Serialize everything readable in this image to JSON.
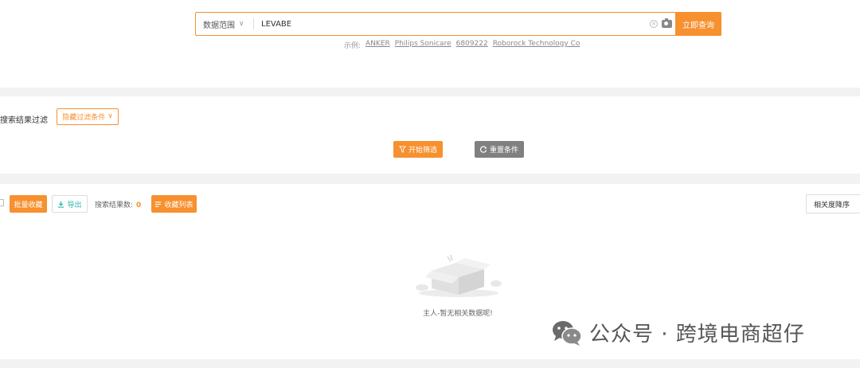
{
  "search": {
    "scope_label": "数据范围",
    "query_value": "LEVABE",
    "submit_label": "立即查询",
    "examples_prefix": "示例:",
    "examples": [
      "ANKER",
      "Philips Sonicare",
      "6809222",
      "Roborock Technology Co"
    ]
  },
  "filter": {
    "section_label": "搜索结果过滤",
    "toggle_label": "隐藏过滤条件",
    "start_label": "开始筛选",
    "reset_label": "重置条件"
  },
  "results": {
    "batch_fav_label": "批量收藏",
    "export_label": "导出",
    "count_label": "搜索结果数:",
    "count_value": "0",
    "fav_list_label": "收藏列表",
    "sort_label": "相关度降序",
    "empty_message": "主人-暂无相关数据呢!"
  },
  "watermark": {
    "text": "公众号 · 跨境电商超仔"
  },
  "icons": {
    "scope_chevron": "chevron-down-icon",
    "clear": "clear-icon",
    "camera": "camera-icon",
    "filter": "filter-icon",
    "refresh": "refresh-icon",
    "download": "download-icon",
    "list": "list-icon",
    "empty_box": "empty-box-icon",
    "wechat": "wechat-icon"
  },
  "colors": {
    "accent": "#f7902f",
    "export_green": "#29b5a8",
    "reset_gray": "#808080"
  }
}
